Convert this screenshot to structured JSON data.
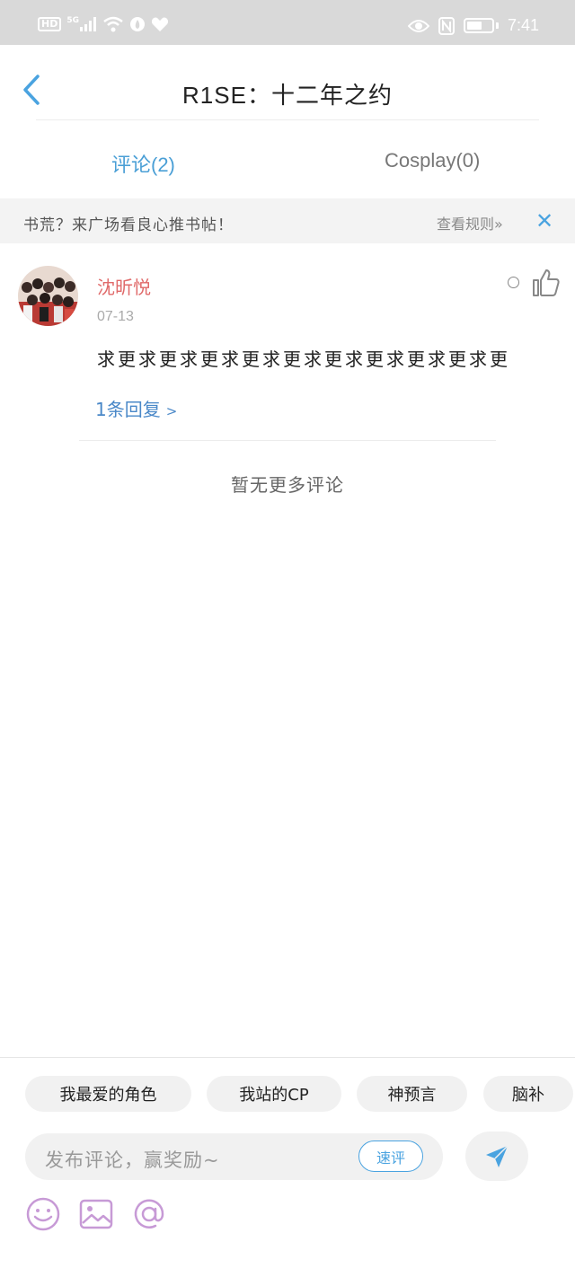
{
  "status_bar": {
    "hd_label": "HD",
    "network_label": "5G",
    "time": "7:41"
  },
  "header": {
    "title": "R1SE：十二年之约",
    "back_icon": "chevron-left-icon"
  },
  "tabs": [
    {
      "label": "评论(2)",
      "active": true
    },
    {
      "label": "Cosplay(0)",
      "active": false
    }
  ],
  "notice": {
    "text": "书荒？来广场看良心推书帖！",
    "link": "查看规则»",
    "close_icon": "close-icon"
  },
  "comment": {
    "username": "沈昕悦",
    "date": "07-13",
    "body": "求更求更求更求更求更求更求更求更求更求更",
    "reply_link": "1条回复",
    "reply_chevron": ">"
  },
  "no_more_text": "暂无更多评论",
  "composer": {
    "chips": [
      "我最爱的角色",
      "我站的CP",
      "神预言",
      "脑补"
    ],
    "placeholder": "发布评论，赢奖励~",
    "quick_review": "速评"
  },
  "colors": {
    "accent": "#4aa3e0",
    "username": "#e06a6a",
    "reply_link": "#4a88c8",
    "tool_icons": "#c79ad6"
  }
}
